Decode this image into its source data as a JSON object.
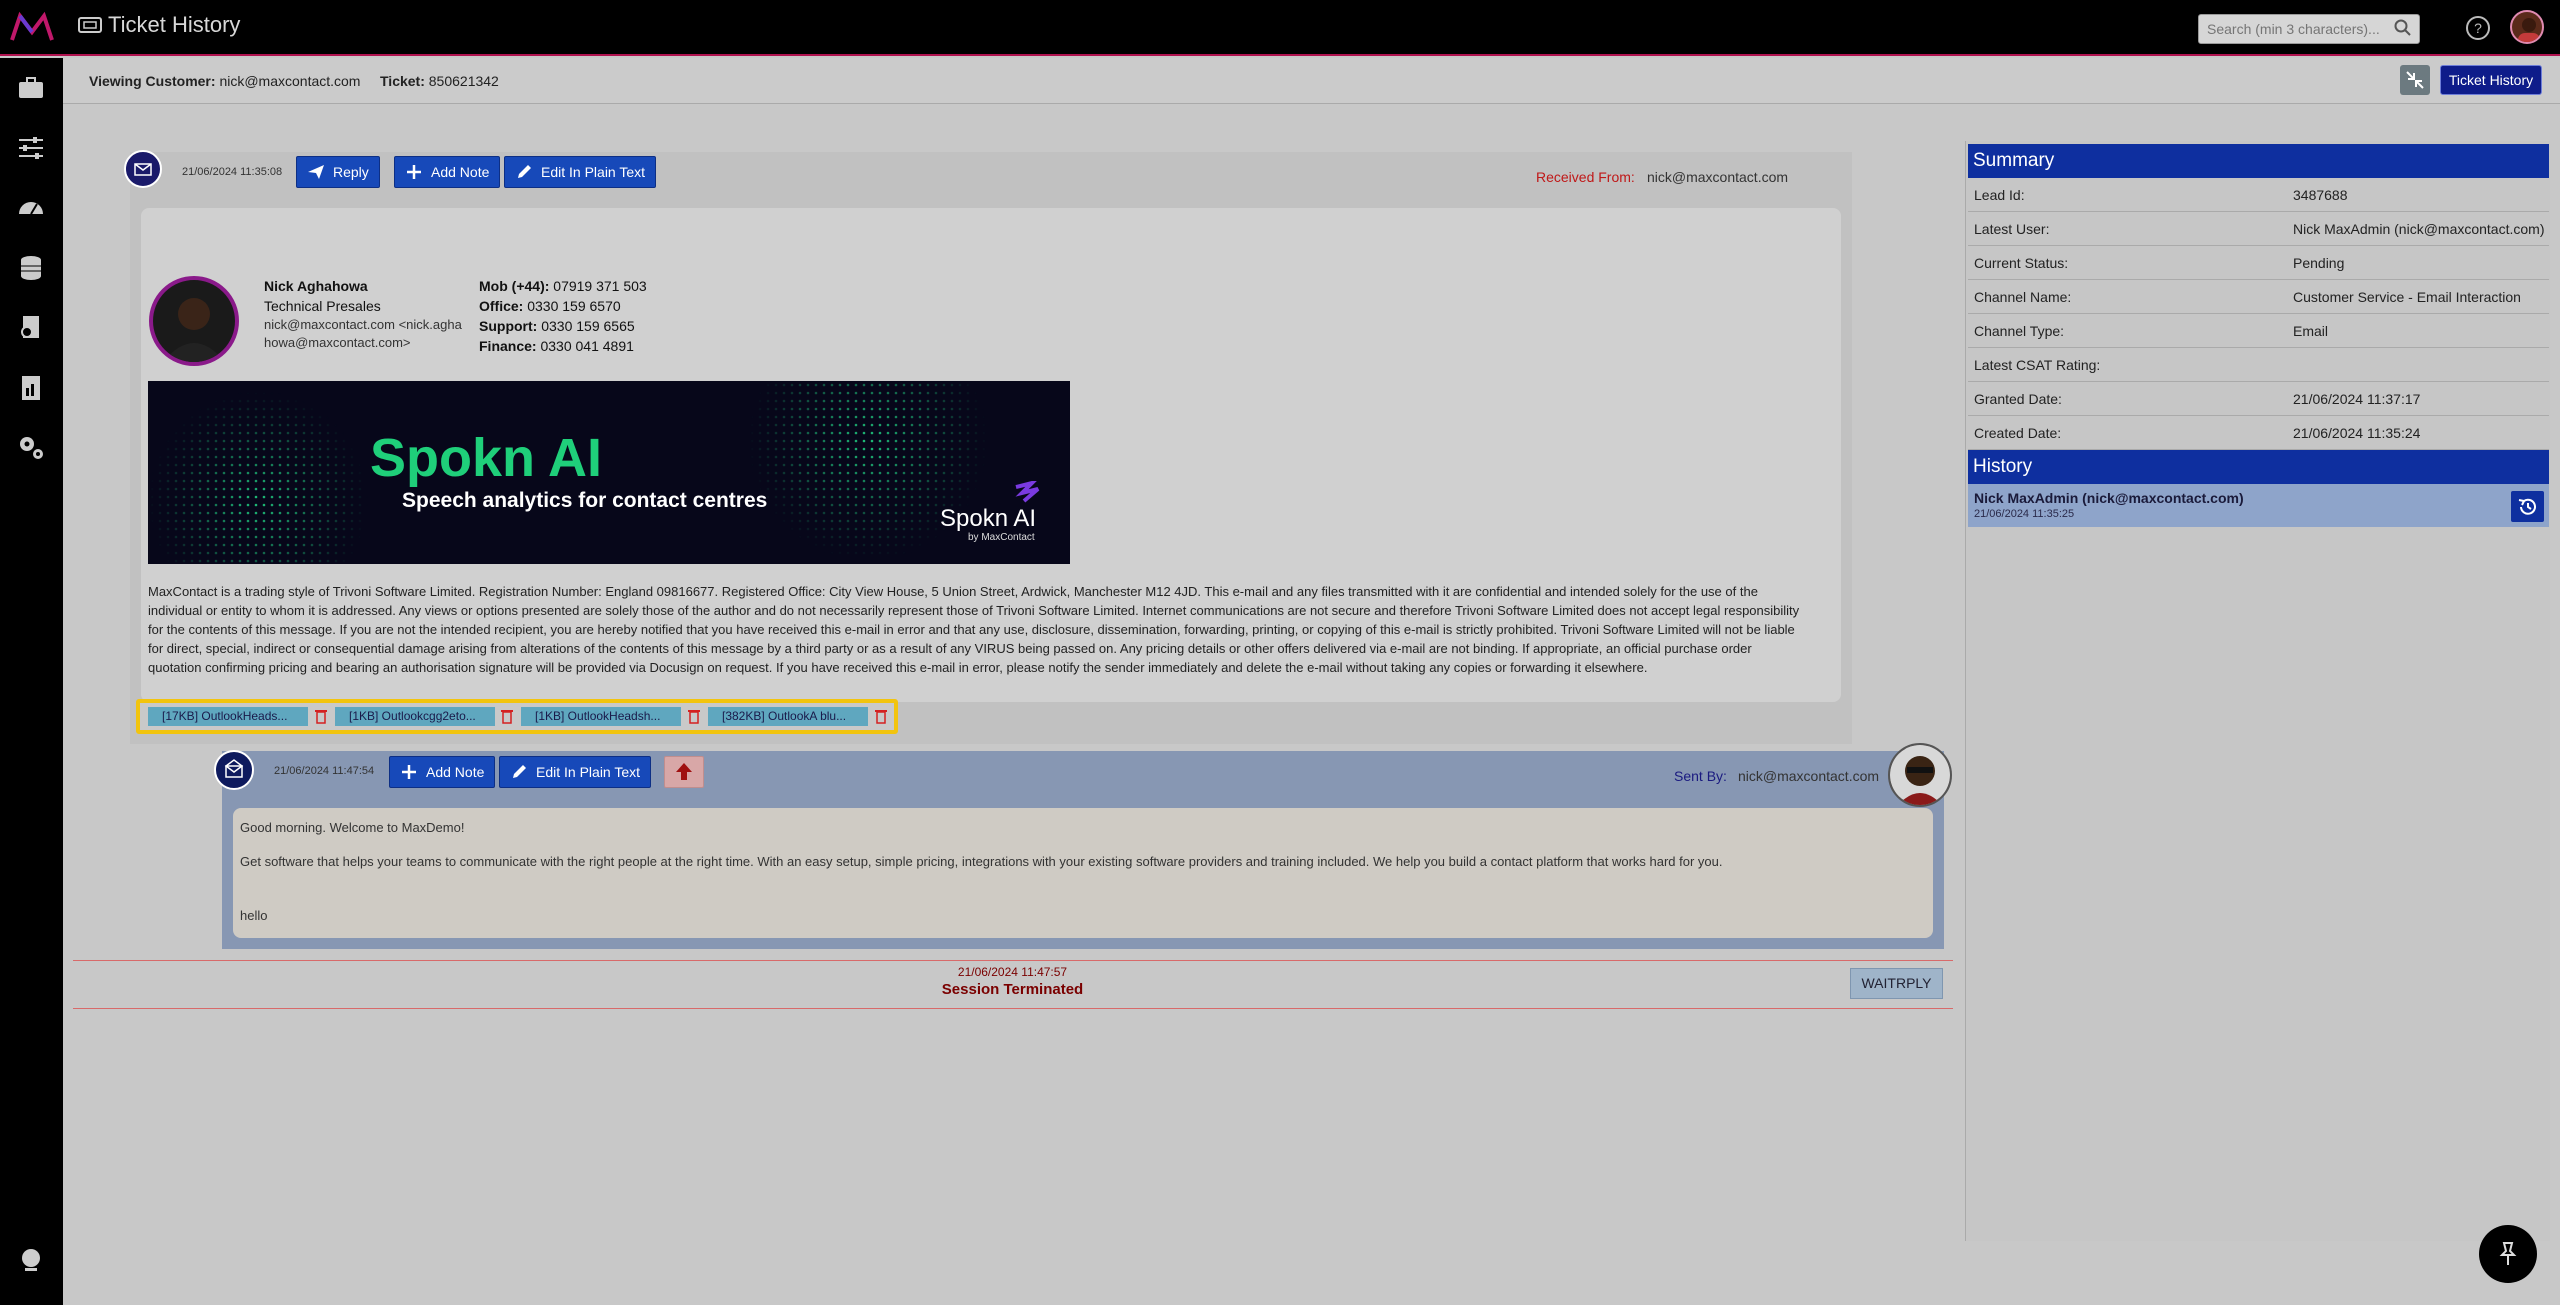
{
  "header": {
    "title": "Ticket History",
    "search_placeholder": "Search (min 3 characters)..."
  },
  "subheader": {
    "customer_label": "Viewing Customer:",
    "customer_value": "nick@maxcontact.com",
    "ticket_label": "Ticket:",
    "ticket_value": "850621342",
    "ticket_history_button": "Ticket History"
  },
  "email1": {
    "timestamp": "21/06/2024 11:35:08",
    "reply_label": "Reply",
    "add_note_label": "Add Note",
    "edit_plain_label": "Edit In Plain Text",
    "received_from_label": "Received From:",
    "received_from_value": "nick@maxcontact.com",
    "signature": {
      "name": "Nick Aghahowa",
      "role": "Technical Presales",
      "email_line1": "nick@maxcontact.com <nick.agha",
      "email_line2": "howa@maxcontact.com>",
      "mob_label": "Mob (+44):",
      "mob_value": "07919 371 503",
      "office_label": "Office:",
      "office_value": "0330 159 6570",
      "support_label": "Support:",
      "support_value": "0330 159 6565",
      "finance_label": "Finance:",
      "finance_value": "0330 041 4891"
    },
    "banner": {
      "title": "Spokn AI",
      "subtitle": "Speech analytics for contact centres",
      "logo_text": "Spokn AI",
      "logo_sub": "by MaxContact"
    },
    "disclaimer": "MaxContact is a trading style of Trivoni Software Limited. Registration Number: England 09816677. Registered Office: City View House, 5 Union Street, Ardwick, Manchester M12 4JD. This e-mail and any files transmitted with it are confidential and intended solely for the use of the individual or entity to whom it is addressed. Any views or options presented are solely those of the author and do not necessarily represent those of Trivoni Software Limited. Internet communications are not secure and therefore Trivoni Software Limited does not accept legal responsibility for the contents of this message. If you are not the intended recipient, you are hereby notified that you have received this e-mail in error and that any use, disclosure, dissemination, forwarding, printing, or copying of this e-mail is strictly prohibited. Trivoni Software Limited will not be liable for direct, special, indirect or consequential damage arising from alterations of the contents of this message by a third party or as a result of any VIRUS being passed on. Any pricing details or other offers delivered via e-mail are not binding. If appropriate, an official purchase order quotation confirming pricing and bearing an authorisation signature will be provided via Docusign on request. If you have received this e-mail in error, please notify the sender immediately and delete the e-mail without taking any copies or forwarding it elsewhere.",
    "attachments": [
      "[17KB] OutlookHeads...",
      "[1KB] Outlookcgg2eto...",
      "[1KB] OutlookHeadsh...",
      "[382KB] OutlookA blu..."
    ]
  },
  "email2": {
    "timestamp": "21/06/2024 11:47:54",
    "add_note_label": "Add Note",
    "edit_plain_label": "Edit In Plain Text",
    "sent_by_label": "Sent By:",
    "sent_by_value": "nick@maxcontact.com",
    "line1": "Good morning. Welcome to MaxDemo!",
    "line2": "Get software that helps your teams to communicate with the right people at the right time. With an easy setup, simple pricing, integrations with your existing software providers and training included. We help you build a contact platform that works hard for you.",
    "line3": "hello"
  },
  "session": {
    "timestamp": "21/06/2024 11:47:57",
    "text": "Session Terminated",
    "status_button": "WAITRPLY"
  },
  "summary": {
    "title": "Summary",
    "rows": [
      {
        "k": "Lead Id:",
        "v": "3487688"
      },
      {
        "k": "Latest User:",
        "v": "Nick MaxAdmin (nick@maxcontact.com)"
      },
      {
        "k": "Current Status:",
        "v": "Pending"
      },
      {
        "k": "Channel Name:",
        "v": "Customer Service - Email Interaction"
      },
      {
        "k": "Channel Type:",
        "v": "Email"
      },
      {
        "k": "Latest CSAT Rating:",
        "v": ""
      },
      {
        "k": "Granted Date:",
        "v": "21/06/2024 11:37:17"
      },
      {
        "k": "Created Date:",
        "v": "21/06/2024 11:35:24"
      }
    ]
  },
  "history": {
    "title": "History",
    "item_name": "Nick MaxAdmin (nick@maxcontact.com)",
    "item_time": "21/06/2024 11:35:25"
  }
}
